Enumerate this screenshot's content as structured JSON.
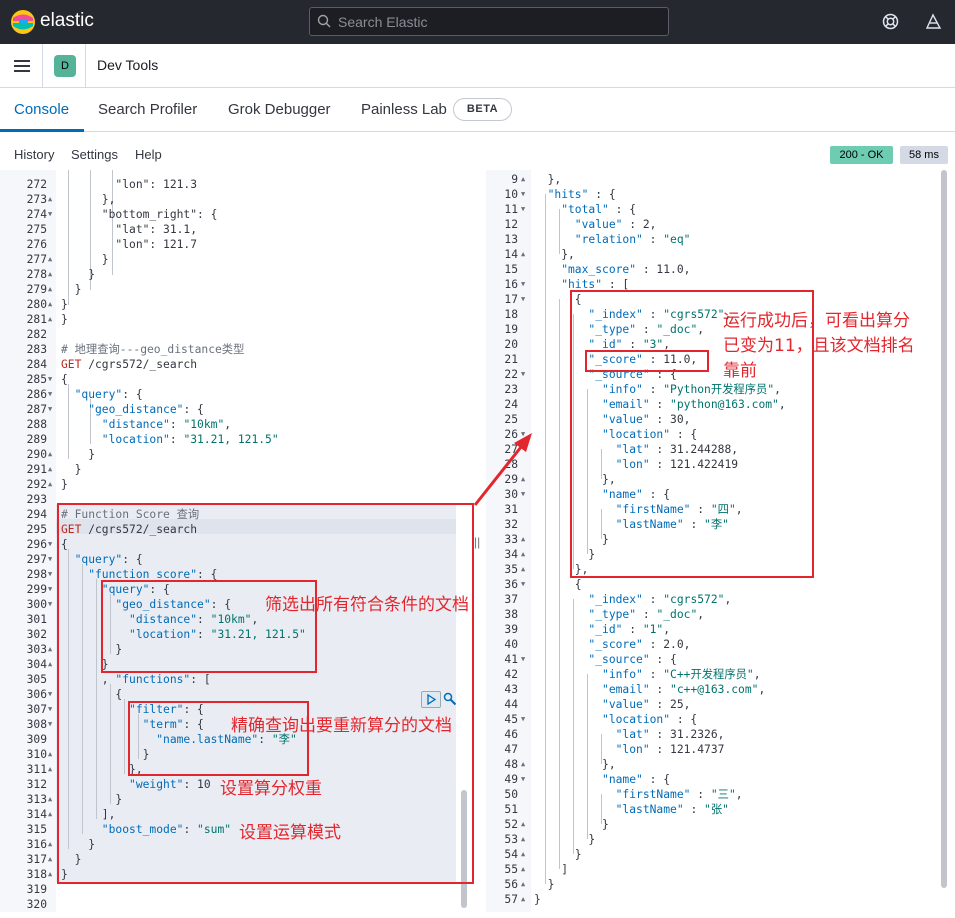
{
  "brand": {
    "name": "elastic"
  },
  "search": {
    "placeholder": "Search Elastic"
  },
  "header": {
    "app_badge": "D",
    "title": "Dev Tools"
  },
  "tabs": [
    {
      "label": "Console"
    },
    {
      "label": "Search Profiler"
    },
    {
      "label": "Grok Debugger"
    },
    {
      "label": "Painless Lab"
    }
  ],
  "beta": "BETA",
  "menu": {
    "history": "History",
    "settings": "Settings",
    "help": "Help"
  },
  "response": {
    "status": "200 - OK",
    "time": "58 ms"
  },
  "annotations": {
    "result": "运行成功后，可看出算分\n已变为11，且该文档排名\n靠前",
    "filter": "筛选出所有符合条件的文档",
    "term": "精确查询出要重新算分的文档",
    "weight": "设置算分权重",
    "mode": "设置运算模式"
  },
  "left_editor": [
    {
      "n": "272",
      "f": "",
      "t": [
        [
          "n",
          "        \"lon\": 121.3"
        ]
      ]
    },
    {
      "n": "273",
      "f": "▲",
      "t": [
        [
          "n",
          "      },"
        ]
      ]
    },
    {
      "n": "274",
      "f": "▼",
      "t": [
        [
          "n",
          "      \"bottom_right\": {"
        ]
      ]
    },
    {
      "n": "275",
      "f": "",
      "t": [
        [
          "n",
          "        \"lat\": 31.1,"
        ]
      ]
    },
    {
      "n": "276",
      "f": "",
      "t": [
        [
          "n",
          "        \"lon\": 121.7"
        ]
      ]
    },
    {
      "n": "277",
      "f": "▲",
      "t": [
        [
          "n",
          "      }"
        ]
      ]
    },
    {
      "n": "278",
      "f": "▲",
      "t": [
        [
          "n",
          "    }"
        ]
      ]
    },
    {
      "n": "279",
      "f": "▲",
      "t": [
        [
          "n",
          "  }"
        ]
      ]
    },
    {
      "n": "280",
      "f": "▲",
      "t": [
        [
          "n",
          "}"
        ]
      ]
    },
    {
      "n": "281",
      "f": "▲",
      "t": [
        [
          "n",
          "}"
        ]
      ]
    },
    {
      "n": "282",
      "f": "",
      "t": [
        [
          "n",
          ""
        ]
      ]
    },
    {
      "n": "283",
      "f": "",
      "t": [
        [
          "c",
          "# 地理查询---geo_distance类型"
        ]
      ]
    },
    {
      "n": "284",
      "f": "",
      "t": [
        [
          "m",
          "GET"
        ],
        [
          "n",
          " /cgrs572/_search"
        ]
      ]
    },
    {
      "n": "285",
      "f": "▼",
      "t": [
        [
          "n",
          "{"
        ]
      ]
    },
    {
      "n": "286",
      "f": "▼",
      "t": [
        [
          "k",
          "  \"query\""
        ],
        [
          "n",
          ": {"
        ]
      ]
    },
    {
      "n": "287",
      "f": "▼",
      "t": [
        [
          "k",
          "    \"geo_distance\""
        ],
        [
          "n",
          ": {"
        ]
      ]
    },
    {
      "n": "288",
      "f": "",
      "t": [
        [
          "k",
          "      \"distance\""
        ],
        [
          "n",
          ": "
        ],
        [
          "s",
          "\"10km\""
        ],
        [
          "n",
          ","
        ]
      ]
    },
    {
      "n": "289",
      "f": "",
      "t": [
        [
          "k",
          "      \"location\""
        ],
        [
          "n",
          ": "
        ],
        [
          "s",
          "\"31.21, 121.5\""
        ]
      ]
    },
    {
      "n": "290",
      "f": "▲",
      "t": [
        [
          "n",
          "    }"
        ]
      ]
    },
    {
      "n": "291",
      "f": "▲",
      "t": [
        [
          "n",
          "  }"
        ]
      ]
    },
    {
      "n": "292",
      "f": "▲",
      "t": [
        [
          "n",
          "}"
        ]
      ]
    },
    {
      "n": "293",
      "f": "",
      "t": [
        [
          "n",
          ""
        ]
      ]
    },
    {
      "n": "294",
      "f": "",
      "t": [
        [
          "c",
          "# Function Score 查询"
        ]
      ]
    },
    {
      "n": "295",
      "f": "",
      "t": [
        [
          "m",
          "GET"
        ],
        [
          "n",
          " /cgrs572/_search"
        ]
      ]
    },
    {
      "n": "296",
      "f": "▼",
      "t": [
        [
          "n",
          "{"
        ]
      ]
    },
    {
      "n": "297",
      "f": "▼",
      "t": [
        [
          "k",
          "  \"query\""
        ],
        [
          "n",
          ": {"
        ]
      ]
    },
    {
      "n": "298",
      "f": "▼",
      "t": [
        [
          "k",
          "    \"function_score\""
        ],
        [
          "n",
          ": {"
        ]
      ]
    },
    {
      "n": "299",
      "f": "▼",
      "t": [
        [
          "k",
          "      \"query\""
        ],
        [
          "n",
          ": {"
        ]
      ]
    },
    {
      "n": "300",
      "f": "▼",
      "t": [
        [
          "k",
          "        \"geo_distance\""
        ],
        [
          "n",
          ": {"
        ]
      ]
    },
    {
      "n": "301",
      "f": "",
      "t": [
        [
          "k",
          "          \"distance\""
        ],
        [
          "n",
          ": "
        ],
        [
          "s",
          "\"10km\""
        ],
        [
          "n",
          ","
        ]
      ]
    },
    {
      "n": "302",
      "f": "",
      "t": [
        [
          "k",
          "          \"location\""
        ],
        [
          "n",
          ": "
        ],
        [
          "s",
          "\"31.21, 121.5\""
        ]
      ]
    },
    {
      "n": "303",
      "f": "▲",
      "t": [
        [
          "n",
          "        }"
        ]
      ]
    },
    {
      "n": "304",
      "f": "▲",
      "t": [
        [
          "n",
          "      }"
        ]
      ]
    },
    {
      "n": "305",
      "f": "",
      "t": [
        [
          "n",
          "      , "
        ],
        [
          "k",
          "\"functions\""
        ],
        [
          "n",
          ": ["
        ]
      ]
    },
    {
      "n": "306",
      "f": "▼",
      "t": [
        [
          "n",
          "        {"
        ]
      ]
    },
    {
      "n": "307",
      "f": "▼",
      "t": [
        [
          "k",
          "          \"filter\""
        ],
        [
          "n",
          ": {"
        ]
      ]
    },
    {
      "n": "308",
      "f": "▼",
      "t": [
        [
          "k",
          "            \"term\""
        ],
        [
          "n",
          ": {"
        ]
      ]
    },
    {
      "n": "309",
      "f": "",
      "t": [
        [
          "k",
          "              \"name.lastName\""
        ],
        [
          "n",
          ": "
        ],
        [
          "s",
          "\"李\""
        ]
      ]
    },
    {
      "n": "310",
      "f": "▲",
      "t": [
        [
          "n",
          "            }"
        ]
      ]
    },
    {
      "n": "311",
      "f": "▲",
      "t": [
        [
          "n",
          "          },"
        ]
      ]
    },
    {
      "n": "312",
      "f": "",
      "t": [
        [
          "k",
          "          \"weight\""
        ],
        [
          "n",
          ": 10"
        ]
      ]
    },
    {
      "n": "313",
      "f": "▲",
      "t": [
        [
          "n",
          "        }"
        ]
      ]
    },
    {
      "n": "314",
      "f": "▲",
      "t": [
        [
          "n",
          "      ],"
        ]
      ]
    },
    {
      "n": "315",
      "f": "",
      "t": [
        [
          "k",
          "      \"boost_mode\""
        ],
        [
          "n",
          ": "
        ],
        [
          "s",
          "\"sum\""
        ]
      ]
    },
    {
      "n": "316",
      "f": "▲",
      "t": [
        [
          "n",
          "    }"
        ]
      ]
    },
    {
      "n": "317",
      "f": "▲",
      "t": [
        [
          "n",
          "  }"
        ]
      ]
    },
    {
      "n": "318",
      "f": "▲",
      "t": [
        [
          "n",
          "}"
        ]
      ]
    },
    {
      "n": "319",
      "f": "",
      "t": [
        [
          "n",
          ""
        ]
      ]
    },
    {
      "n": "320",
      "f": "",
      "t": [
        [
          "n",
          ""
        ]
      ]
    }
  ],
  "right_editor": [
    {
      "n": "9",
      "f": "▲",
      "t": [
        [
          "n",
          "  },"
        ]
      ]
    },
    {
      "n": "10",
      "f": "▼",
      "t": [
        [
          "k",
          "  \"hits\""
        ],
        [
          "n",
          " : {"
        ]
      ]
    },
    {
      "n": "11",
      "f": "▼",
      "t": [
        [
          "k",
          "    \"total\""
        ],
        [
          "n",
          " : {"
        ]
      ]
    },
    {
      "n": "12",
      "f": "",
      "t": [
        [
          "k",
          "      \"value\""
        ],
        [
          "n",
          " : 2,"
        ]
      ]
    },
    {
      "n": "13",
      "f": "",
      "t": [
        [
          "k",
          "      \"relation\""
        ],
        [
          "n",
          " : "
        ],
        [
          "s",
          "\"eq\""
        ]
      ]
    },
    {
      "n": "14",
      "f": "▲",
      "t": [
        [
          "n",
          "    },"
        ]
      ]
    },
    {
      "n": "15",
      "f": "",
      "t": [
        [
          "k",
          "    \"max_score\""
        ],
        [
          "n",
          " : 11.0,"
        ]
      ]
    },
    {
      "n": "16",
      "f": "▼",
      "t": [
        [
          "k",
          "    \"hits\""
        ],
        [
          "n",
          " : ["
        ]
      ]
    },
    {
      "n": "17",
      "f": "▼",
      "t": [
        [
          "n",
          "      {"
        ]
      ]
    },
    {
      "n": "18",
      "f": "",
      "t": [
        [
          "k",
          "        \"_index\""
        ],
        [
          "n",
          " : "
        ],
        [
          "s",
          "\"cgrs572\""
        ],
        [
          "n",
          ","
        ]
      ]
    },
    {
      "n": "19",
      "f": "",
      "t": [
        [
          "k",
          "        \"_type\""
        ],
        [
          "n",
          " : "
        ],
        [
          "s",
          "\"_doc\""
        ],
        [
          "n",
          ","
        ]
      ]
    },
    {
      "n": "20",
      "f": "",
      "t": [
        [
          "k",
          "        \"_id\""
        ],
        [
          "n",
          " : "
        ],
        [
          "s",
          "\"3\""
        ],
        [
          "n",
          ","
        ]
      ]
    },
    {
      "n": "21",
      "f": "",
      "t": [
        [
          "k",
          "        \"_score\""
        ],
        [
          "n",
          " : 11.0,"
        ]
      ]
    },
    {
      "n": "22",
      "f": "▼",
      "t": [
        [
          "k",
          "        \"_source\""
        ],
        [
          "n",
          " : {"
        ]
      ]
    },
    {
      "n": "23",
      "f": "",
      "t": [
        [
          "k",
          "          \"info\""
        ],
        [
          "n",
          " : "
        ],
        [
          "s",
          "\"Python开发程序员\""
        ],
        [
          "n",
          ","
        ]
      ]
    },
    {
      "n": "24",
      "f": "",
      "t": [
        [
          "k",
          "          \"email\""
        ],
        [
          "n",
          " : "
        ],
        [
          "s",
          "\"python@163.com\""
        ],
        [
          "n",
          ","
        ]
      ]
    },
    {
      "n": "25",
      "f": "",
      "t": [
        [
          "k",
          "          \"value\""
        ],
        [
          "n",
          " : 30,"
        ]
      ]
    },
    {
      "n": "26",
      "f": "▼",
      "t": [
        [
          "k",
          "          \"location\""
        ],
        [
          "n",
          " : {"
        ]
      ]
    },
    {
      "n": "27",
      "f": "",
      "t": [
        [
          "k",
          "            \"lat\""
        ],
        [
          "n",
          " : 31.244288,"
        ]
      ]
    },
    {
      "n": "28",
      "f": "",
      "t": [
        [
          "k",
          "            \"lon\""
        ],
        [
          "n",
          " : 121.422419"
        ]
      ]
    },
    {
      "n": "29",
      "f": "▲",
      "t": [
        [
          "n",
          "          },"
        ]
      ]
    },
    {
      "n": "30",
      "f": "▼",
      "t": [
        [
          "k",
          "          \"name\""
        ],
        [
          "n",
          " : {"
        ]
      ]
    },
    {
      "n": "31",
      "f": "",
      "t": [
        [
          "k",
          "            \"firstName\""
        ],
        [
          "n",
          " : "
        ],
        [
          "s",
          "\"四\""
        ],
        [
          "n",
          ","
        ]
      ]
    },
    {
      "n": "32",
      "f": "",
      "t": [
        [
          "k",
          "            \"lastName\""
        ],
        [
          "n",
          " : "
        ],
        [
          "s",
          "\"李\""
        ]
      ]
    },
    {
      "n": "33",
      "f": "▲",
      "t": [
        [
          "n",
          "          }"
        ]
      ]
    },
    {
      "n": "34",
      "f": "▲",
      "t": [
        [
          "n",
          "        }"
        ]
      ]
    },
    {
      "n": "35",
      "f": "▲",
      "t": [
        [
          "n",
          "      },"
        ]
      ]
    },
    {
      "n": "36",
      "f": "▼",
      "t": [
        [
          "n",
          "      {"
        ]
      ]
    },
    {
      "n": "37",
      "f": "",
      "t": [
        [
          "k",
          "        \"_index\""
        ],
        [
          "n",
          " : "
        ],
        [
          "s",
          "\"cgrs572\""
        ],
        [
          "n",
          ","
        ]
      ]
    },
    {
      "n": "38",
      "f": "",
      "t": [
        [
          "k",
          "        \"_type\""
        ],
        [
          "n",
          " : "
        ],
        [
          "s",
          "\"_doc\""
        ],
        [
          "n",
          ","
        ]
      ]
    },
    {
      "n": "39",
      "f": "",
      "t": [
        [
          "k",
          "        \"_id\""
        ],
        [
          "n",
          " : "
        ],
        [
          "s",
          "\"1\""
        ],
        [
          "n",
          ","
        ]
      ]
    },
    {
      "n": "40",
      "f": "",
      "t": [
        [
          "k",
          "        \"_score\""
        ],
        [
          "n",
          " : 2.0,"
        ]
      ]
    },
    {
      "n": "41",
      "f": "▼",
      "t": [
        [
          "k",
          "        \"_source\""
        ],
        [
          "n",
          " : {"
        ]
      ]
    },
    {
      "n": "42",
      "f": "",
      "t": [
        [
          "k",
          "          \"info\""
        ],
        [
          "n",
          " : "
        ],
        [
          "s",
          "\"C++开发程序员\""
        ],
        [
          "n",
          ","
        ]
      ]
    },
    {
      "n": "43",
      "f": "",
      "t": [
        [
          "k",
          "          \"email\""
        ],
        [
          "n",
          " : "
        ],
        [
          "s",
          "\"c++@163.com\""
        ],
        [
          "n",
          ","
        ]
      ]
    },
    {
      "n": "44",
      "f": "",
      "t": [
        [
          "k",
          "          \"value\""
        ],
        [
          "n",
          " : 25,"
        ]
      ]
    },
    {
      "n": "45",
      "f": "▼",
      "t": [
        [
          "k",
          "          \"location\""
        ],
        [
          "n",
          " : {"
        ]
      ]
    },
    {
      "n": "46",
      "f": "",
      "t": [
        [
          "k",
          "            \"lat\""
        ],
        [
          "n",
          " : 31.2326,"
        ]
      ]
    },
    {
      "n": "47",
      "f": "",
      "t": [
        [
          "k",
          "            \"lon\""
        ],
        [
          "n",
          " : 121.4737"
        ]
      ]
    },
    {
      "n": "48",
      "f": "▲",
      "t": [
        [
          "n",
          "          },"
        ]
      ]
    },
    {
      "n": "49",
      "f": "▼",
      "t": [
        [
          "k",
          "          \"name\""
        ],
        [
          "n",
          " : {"
        ]
      ]
    },
    {
      "n": "50",
      "f": "",
      "t": [
        [
          "k",
          "            \"firstName\""
        ],
        [
          "n",
          " : "
        ],
        [
          "s",
          "\"三\""
        ],
        [
          "n",
          ","
        ]
      ]
    },
    {
      "n": "51",
      "f": "",
      "t": [
        [
          "k",
          "            \"lastName\""
        ],
        [
          "n",
          " : "
        ],
        [
          "s",
          "\"张\""
        ]
      ]
    },
    {
      "n": "52",
      "f": "▲",
      "t": [
        [
          "n",
          "          }"
        ]
      ]
    },
    {
      "n": "53",
      "f": "▲",
      "t": [
        [
          "n",
          "        }"
        ]
      ]
    },
    {
      "n": "54",
      "f": "▲",
      "t": [
        [
          "n",
          "      }"
        ]
      ]
    },
    {
      "n": "55",
      "f": "▲",
      "t": [
        [
          "n",
          "    ]"
        ]
      ]
    },
    {
      "n": "56",
      "f": "▲",
      "t": [
        [
          "n",
          "  }"
        ]
      ]
    },
    {
      "n": "57",
      "f": "▲",
      "t": [
        [
          "n",
          "}"
        ]
      ]
    }
  ]
}
